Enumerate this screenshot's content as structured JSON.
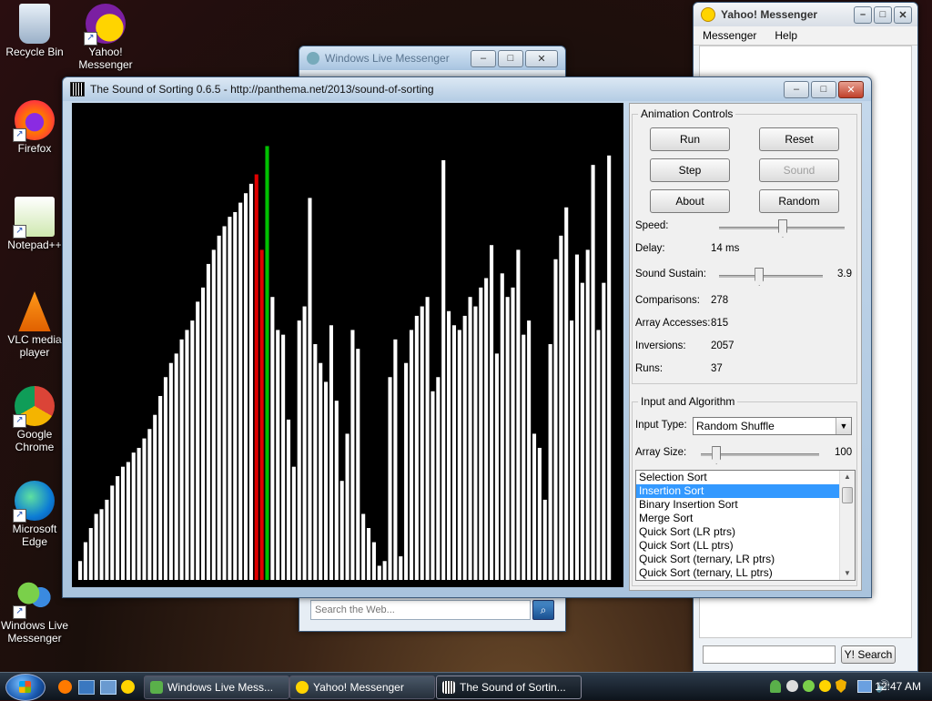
{
  "desktop": {
    "icons": [
      {
        "label": "Recycle Bin"
      },
      {
        "label": "Yahoo! Messenger"
      },
      {
        "label": "Firefox"
      },
      {
        "label": "Notepad++"
      },
      {
        "label": "VLC media player"
      },
      {
        "label": "Google Chrome"
      },
      {
        "label": "Microsoft Edge"
      },
      {
        "label": "Windows Live Messenger"
      }
    ]
  },
  "wlm_window": {
    "title": "Windows Live Messenger",
    "search_placeholder": "Search the Web..."
  },
  "yahoo_window": {
    "title": "Yahoo! Messenger",
    "menu": [
      "Messenger",
      "Help"
    ],
    "search_button": "Y! Search"
  },
  "sos_window": {
    "title": "The Sound of Sorting 0.6.5 - http://panthema.net/2013/sound-of-sorting",
    "animation_controls": {
      "legend": "Animation Controls",
      "buttons": {
        "run": "Run",
        "reset": "Reset",
        "step": "Step",
        "sound": "Sound",
        "about": "About",
        "random": "Random"
      },
      "speed_label": "Speed:",
      "delay_label": "Delay:",
      "delay_value": "14 ms",
      "sustain_label": "Sound Sustain:",
      "sustain_value": "3.9",
      "comparisons_label": "Comparisons:",
      "comparisons_value": "278",
      "accesses_label": "Array Accesses:",
      "accesses_value": "815",
      "inversions_label": "Inversions:",
      "inversions_value": "2057",
      "runs_label": "Runs:",
      "runs_value": "37",
      "speed_level": 0.5,
      "sustain_level": 0.37
    },
    "input_algorithm": {
      "legend": "Input and Algorithm",
      "input_type_label": "Input Type:",
      "input_type_value": "Random Shuffle",
      "array_size_label": "Array Size:",
      "array_size_value": "100",
      "array_size_level": 0.1,
      "algorithms": [
        "Selection Sort",
        "Insertion Sort",
        "Binary Insertion Sort",
        "Merge Sort",
        "Quick Sort (LR ptrs)",
        "Quick Sort (LL ptrs)",
        "Quick Sort (ternary, LR ptrs)",
        "Quick Sort (ternary, LL ptrs)"
      ],
      "selected_algorithm": "Insertion Sort"
    },
    "visualization": {
      "bar_color": "#ffffff",
      "highlight_red": "#e00000",
      "highlight_green": "#00c000",
      "bars": [
        4,
        8,
        11,
        14,
        15,
        17,
        20,
        22,
        24,
        25,
        27,
        28,
        30,
        32,
        35,
        39,
        43,
        46,
        48,
        51,
        53,
        55,
        59,
        62,
        67,
        70,
        73,
        75,
        77,
        78,
        80,
        82,
        84,
        86,
        70,
        92,
        60,
        53,
        52,
        34,
        24,
        55,
        58,
        81,
        50,
        46,
        42,
        54,
        38,
        21,
        31,
        53,
        49,
        14,
        11,
        8,
        3,
        4,
        43,
        51,
        5,
        46,
        53,
        56,
        58,
        60,
        40,
        43,
        89,
        57,
        54,
        53,
        56,
        60,
        58,
        62,
        64,
        71,
        48,
        65,
        60,
        62,
        70,
        52,
        55,
        31,
        28,
        17,
        50,
        68,
        73,
        79,
        55,
        69,
        63,
        70,
        88,
        53,
        63,
        90
      ],
      "red_indices": [
        33,
        34
      ],
      "green_indices": [
        35
      ]
    }
  },
  "taskbar": {
    "tasks": [
      {
        "label": "Windows Live Mess..."
      },
      {
        "label": "Yahoo! Messenger"
      },
      {
        "label": "The Sound of Sortin..."
      }
    ],
    "clock": "12:47 AM"
  },
  "colors": {
    "selection": "#3399ff",
    "taskbar": "#1a2430"
  }
}
